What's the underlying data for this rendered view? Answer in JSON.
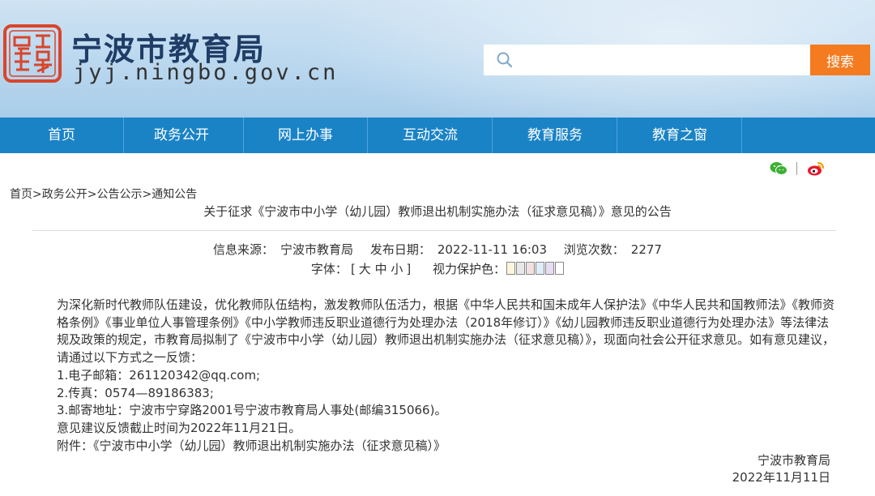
{
  "header": {
    "site_name": "宁波市教育局",
    "site_domain": "jyj.ningbo.gov.cn",
    "search_placeholder": "",
    "search_button": "搜索",
    "accent_color": "#f47b20",
    "seal_color": "#d9452b"
  },
  "nav": {
    "color": "#1a83c6",
    "items": [
      {
        "label": "首页"
      },
      {
        "label": "政务公开"
      },
      {
        "label": "网上办事"
      },
      {
        "label": "互动交流"
      },
      {
        "label": "教育服务"
      },
      {
        "label": "教育之窗"
      }
    ]
  },
  "share": {
    "icons": [
      "wechat-icon",
      "weibo-icon"
    ],
    "separator": "|"
  },
  "article": {
    "breadcrumb": "首页>政务公开>公告公示>通知公告",
    "title": "关于征求《宁波市中小学（幼儿园）教师退出机制实施办法（征求意见稿）》意见的公告",
    "meta": {
      "source_label": "信息来源：",
      "source": "宁波市教育局",
      "date_label": "发布日期：",
      "date": "2022-11-11 16:03",
      "views_label": "浏览次数：",
      "views": "2277"
    },
    "font_size": {
      "label": "字体：",
      "open": "[",
      "large": "大",
      "medium": "中",
      "small": "小",
      "close": "]",
      "eye_label": "视力保护色：",
      "eye_colors": [
        "#fdf6dc",
        "#e8e8e8",
        "#f4e0e0",
        "#e0ecf8",
        "#e8dcf4",
        "#ffffff"
      ]
    },
    "body": {
      "intro": "为深化新时代教师队伍建设，优化教师队伍结构，激发教师队伍活力，根据《中华人民共和国未成年人保护法》《中华人民共和国教师法》《教师资格条例》《事业单位人事管理条例》《中小学教师违反职业道德行为处理办法（2018年修订）》《幼儿园教师违反职业道德行为处理办法》等法律法规及政策的规定，市教育局拟制了《宁波市中小学（幼儿园）教师退出机制实施办法（征求意见稿）》，现面向社会公开征求意见。如有意见建议，请通过以下方式之一反馈：",
      "email": "1.电子邮箱：261120342@qq.com;",
      "fax": "2.传真：0574—89186383;",
      "mail": "3.邮寄地址：宁波市宁穿路2001号宁波市教育局人事处(邮编315066)。",
      "deadline": "意见建议反馈截止时间为2022年11月21日。",
      "attachment_label": "附件：",
      "attachment": "《宁波市中小学（幼儿园）教师退出机制实施办法（征求意见稿）》"
    },
    "signature": {
      "org": "宁波市教育局",
      "date": "2022年11月11日"
    }
  }
}
